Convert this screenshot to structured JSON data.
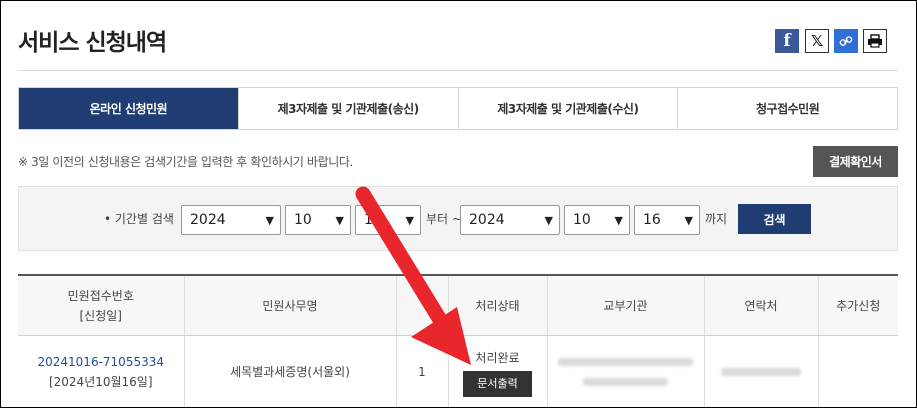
{
  "header": {
    "title": "서비스 신청내역",
    "share": {
      "facebook": "f",
      "x": "𝕏",
      "link": "🔗",
      "print": "⎙"
    }
  },
  "tabs": [
    {
      "label": "온라인 신청민원",
      "active": true
    },
    {
      "label": "제3자제출 및 기관제출(송신)",
      "active": false
    },
    {
      "label": "제3자제출 및 기관제출(수신)",
      "active": false
    },
    {
      "label": "청구접수민원",
      "active": false
    }
  ],
  "notice": "※ 3일 이전의 신청내용은 검색기간을 입력한 후 확인하시기 바랍니다.",
  "payment_button": "결제확인서",
  "search": {
    "label": "• 기간별 검색",
    "from_year": "2024",
    "from_month": "10",
    "from_day": "16",
    "between": "부터 ~",
    "to_year": "2024",
    "to_month": "10",
    "to_day": "16",
    "until": "까지",
    "button": "검색"
  },
  "table": {
    "headers": {
      "receipt": "민원접수번호",
      "receipt_sub": "[신청일]",
      "service": "민원사무명",
      "qty": "",
      "status": "처리상태",
      "agency": "교부기관",
      "contact": "연락처",
      "extra": "추가신청"
    },
    "rows": [
      {
        "receipt_no": "20241016-71055334",
        "date": "[2024년10월16일]",
        "service": "세목별과세증명(서울외)",
        "qty": "1",
        "status": "처리완료",
        "print_button": "문서출력"
      }
    ]
  }
}
